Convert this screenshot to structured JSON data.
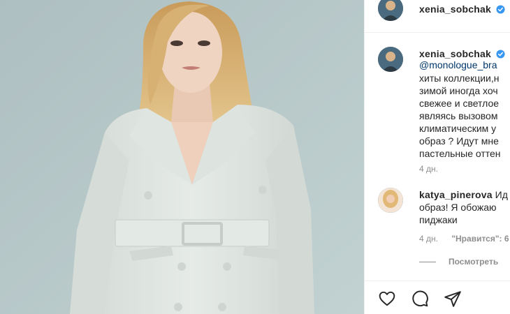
{
  "post": {
    "username": "xenia_sobchak",
    "verified": true,
    "image_alt": "photo"
  },
  "caption": {
    "username": "xenia_sobchak",
    "lines": [
      "@monologue_bra",
      "хиты коллекции,н",
      "зимой иногда хоч",
      "свежее и светлое",
      "являясь вызовом",
      "климатическим у",
      "образ ? Идут мне",
      "пастельные оттен"
    ],
    "time": "4 дн."
  },
  "comment": {
    "username": "katya_pinerova",
    "text_first": "Ид",
    "lines": [
      "образ! Я обожаю",
      "пиджаки"
    ],
    "time": "4 дн.",
    "likes": "\"Нравится\": 6"
  },
  "replies": {
    "label": "Посмотреть"
  },
  "icons": {
    "like": "heart-icon",
    "comment": "comment-icon",
    "share": "share-icon",
    "verified": "verified-badge-icon"
  },
  "colors": {
    "verified": "#3897f0",
    "link": "#00376b",
    "muted": "#8e8e8e",
    "photo_bg": "#b5c8c8"
  }
}
